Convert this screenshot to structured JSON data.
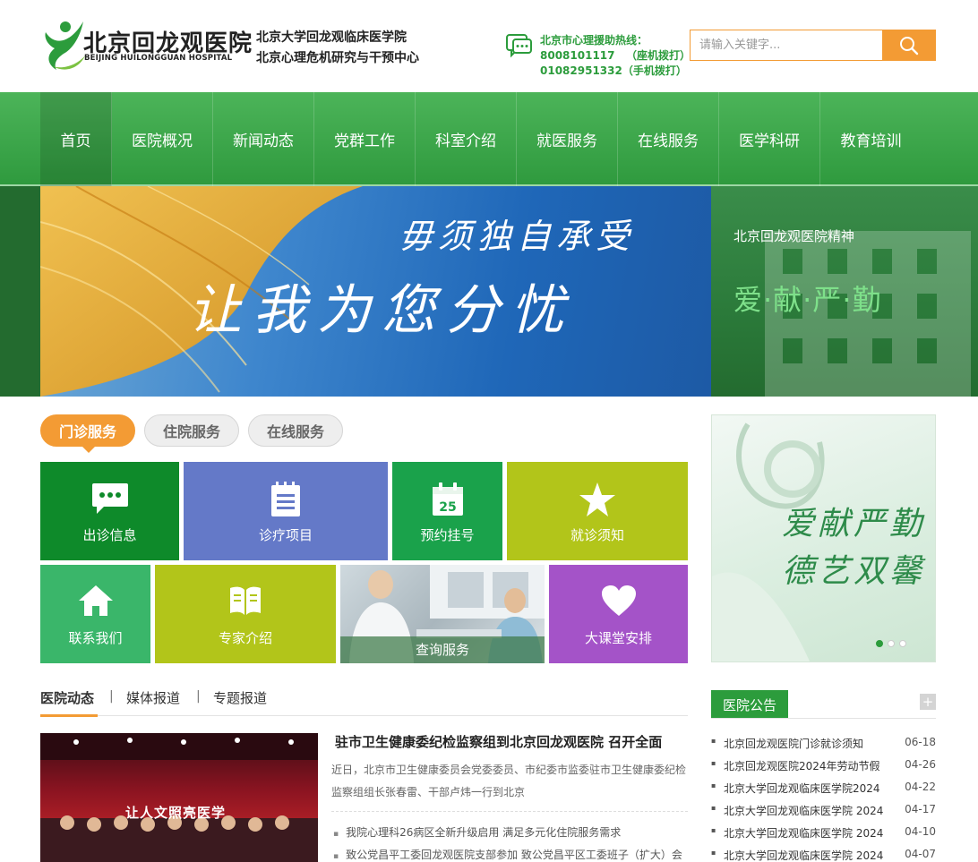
{
  "header": {
    "logo_cn": "北京回龙观医院",
    "logo_en": "BEIJING HUILONGGUAN HOSPITAL",
    "sub1": "北京大学回龙观临床医学院",
    "sub2": "北京心理危机研究与干预中心",
    "hotline_title": "北京市心理援助热线：",
    "hotline1": "8008101117   （座机拨打）",
    "hotline2": "01082951332（手机拨打）",
    "search_placeholder": "请输入关键字...",
    "brand_color": "#2c9c3c",
    "accent_color": "#f39b34"
  },
  "nav": {
    "items": [
      {
        "label": "首页",
        "active": true
      },
      {
        "label": "医院概况"
      },
      {
        "label": "新闻动态"
      },
      {
        "label": "党群工作"
      },
      {
        "label": "科室介绍"
      },
      {
        "label": "就医服务"
      },
      {
        "label": "在线服务"
      },
      {
        "label": "医学科研"
      },
      {
        "label": "教育培训"
      }
    ]
  },
  "banner": {
    "line1": "毋须独自承受",
    "line2": "让我为您分忧",
    "side_title": "北京回龙观医院精神",
    "side_motto": "爱·献·严·勤"
  },
  "service_tabs": [
    "门诊服务",
    "住院服务",
    "在线服务"
  ],
  "tiles": [
    {
      "label": "出诊信息",
      "icon": "chat-icon",
      "color": "#0e8a2a"
    },
    {
      "label": "诊疗项目",
      "icon": "notepad-icon",
      "color": "#6479c8"
    },
    {
      "label": "预约挂号",
      "icon": "calendar-icon",
      "color": "#1aa24b",
      "calendar_day": "25"
    },
    {
      "label": "就诊须知",
      "icon": "star-icon",
      "color": "#b2c51a"
    },
    {
      "label": "联系我们",
      "icon": "home-icon",
      "color": "#3ab66a"
    },
    {
      "label": "专家介绍",
      "icon": "book-icon",
      "color": "#b2c51a"
    },
    {
      "label": "查询服务",
      "icon": "photo-doctor",
      "color": "#9aa7ae"
    },
    {
      "label": "大课堂安排",
      "icon": "heart-icon",
      "color": "#a453c8"
    }
  ],
  "ad": {
    "line1": "爱献严勤",
    "line2": "德艺双馨",
    "dots": 3,
    "active_dot": 0
  },
  "news_tabs": [
    "医院动态",
    "媒体报道",
    "专题报道"
  ],
  "news": {
    "title": "驻市卫生健康委纪检监察组到北京回龙观医院 召开全面",
    "summary": "近日，北京市卫生健康委员会党委委员、市纪委市监委驻市卫生健康委纪检监察组组长张春雷、干部卢炜一行到北京",
    "image_text": "让人文照亮医学",
    "list": [
      "我院心理科26病区全新升级启用 满足多元化住院服务需求",
      "致公党昌平工委回龙观医院支部参加 致公党昌平区工委班子（扩大）会"
    ]
  },
  "notice": {
    "title": "医院公告",
    "more": "+",
    "items": [
      {
        "title": "北京回龙观医院门诊就诊须知",
        "date": "06-18"
      },
      {
        "title": "北京回龙观医院2024年劳动节假",
        "date": "04-26"
      },
      {
        "title": "北京大学回龙观临床医学院2024",
        "date": "04-22"
      },
      {
        "title": "北京大学回龙观临床医学院 2024",
        "date": "04-17"
      },
      {
        "title": "北京大学回龙观临床医学院 2024",
        "date": "04-10"
      },
      {
        "title": "北京大学回龙观临床医学院 2024",
        "date": "04-07"
      }
    ]
  }
}
